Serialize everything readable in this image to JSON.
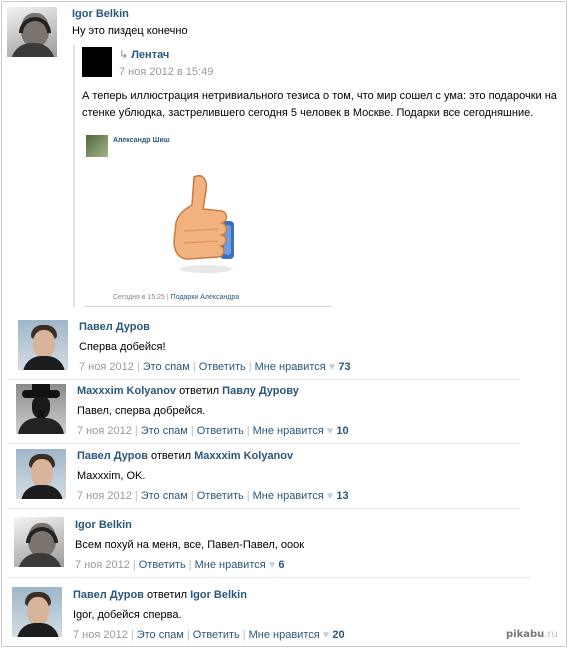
{
  "post": {
    "author": "Igor Belkin",
    "text": "Ну это пиздец конечно",
    "repost": {
      "source": "Лентач",
      "date": "7 ноя 2012 в 15:49",
      "text_line1": "А теперь иллюстрация нетривиального тезиса о том, что мир сошел с ума: это подарочки на",
      "text_line2": "стенке ублюдка, застрелившего сегодня 5 человек в Москве. Подарки все сегодняшние.",
      "inner_name": "Александр Шиш",
      "inner_meta_time": "Сегодня в 15:25",
      "inner_meta_link": "Подарки Александра"
    }
  },
  "actions": {
    "spam": "Это спам",
    "reply": "Ответить",
    "like": "Мне нравится",
    "replied_to": "ответил"
  },
  "comments": [
    {
      "author": "Павел Дуров",
      "to": "",
      "text": "Сперва добейся!",
      "date": "7 ноя 2012",
      "likes": "73",
      "avatar": "pavel",
      "has_spam": true
    },
    {
      "author": "Maxxxim Kolyanov",
      "to": "Павлу Дурову",
      "text": "Павел, сперва добрейся.",
      "date": "7 ноя 2012",
      "likes": "10",
      "avatar": "max",
      "has_spam": true
    },
    {
      "author": "Павел Дуров",
      "to": "Maxxxim Kolyanov",
      "text": "Maxxxim, OK.",
      "date": "7 ноя 2012",
      "likes": "13",
      "avatar": "pavel",
      "has_spam": true
    },
    {
      "author": "Igor Belkin",
      "to": "",
      "text": "Всем похуй на меня, все, Павел-Павел, ооок",
      "date": "7 ноя 2012",
      "likes": "6",
      "avatar": "igor",
      "has_spam": false
    },
    {
      "author": "Павел Дуров",
      "to": "Igor Belkin",
      "text": "Igor, добейся сперва.",
      "date": "7 ноя 2012",
      "likes": "20",
      "avatar": "pavel",
      "has_spam": true
    }
  ],
  "watermark": {
    "main": "pikabu",
    "tld": ".ru"
  },
  "icons": {
    "repost": "repost-arrow-icon",
    "heart": "heart-icon"
  },
  "colors": {
    "link": "#2b587a",
    "meta": "#999999",
    "heart": "#c5d0db"
  }
}
